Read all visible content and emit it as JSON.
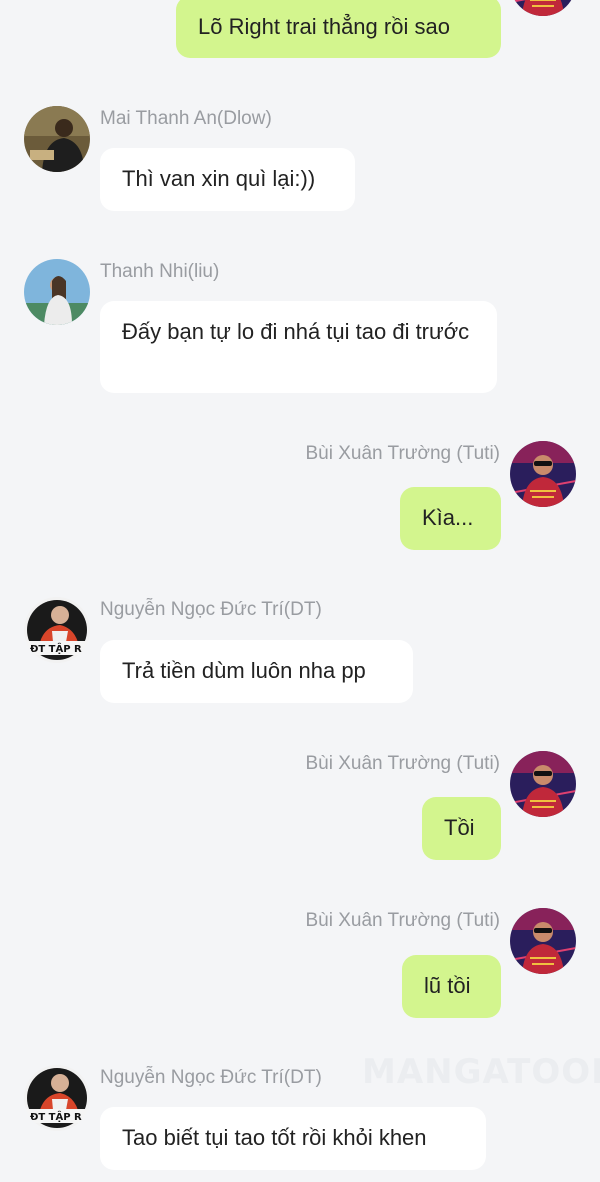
{
  "messages": [
    {
      "side": "right",
      "name": "",
      "text": "Lõ Right trai thẳng rồi sao",
      "avatar": "avatar-tuti"
    },
    {
      "side": "left",
      "name": "Mai Thanh An(Dlow)",
      "text": "Thì van xin quì lại:))",
      "avatar": "avatar-dlow"
    },
    {
      "side": "left",
      "name": "Thanh Nhi(liu)",
      "text": "Đấy bạn tự lo đi nhá tụi tao đi trước",
      "avatar": "avatar-liu"
    },
    {
      "side": "right",
      "name": "Bùi Xuân Trường (Tuti)",
      "text": "Kìa...",
      "avatar": "avatar-tuti"
    },
    {
      "side": "left",
      "name": "Nguyễn Ngọc Đức Trí(DT)",
      "text": "Trả tiền dùm luôn nha pp",
      "avatar": "avatar-dt"
    },
    {
      "side": "right",
      "name": "Bùi Xuân Trường (Tuti)",
      "text": "Tồi",
      "avatar": "avatar-tuti"
    },
    {
      "side": "right",
      "name": "Bùi Xuân Trường (Tuti)",
      "text": "lũ tồi",
      "avatar": "avatar-tuti"
    },
    {
      "side": "left",
      "name": "Nguyễn Ngọc Đức Trí(DT)",
      "text": "Tao biết tụi tao tốt rồi khỏi khen",
      "avatar": "avatar-dt"
    }
  ],
  "watermark": "MANGATOON",
  "colors": {
    "background": "#f4f5f7",
    "bubble_left": "#ffffff",
    "bubble_right": "#d3f58e",
    "name": "#999ca1"
  }
}
